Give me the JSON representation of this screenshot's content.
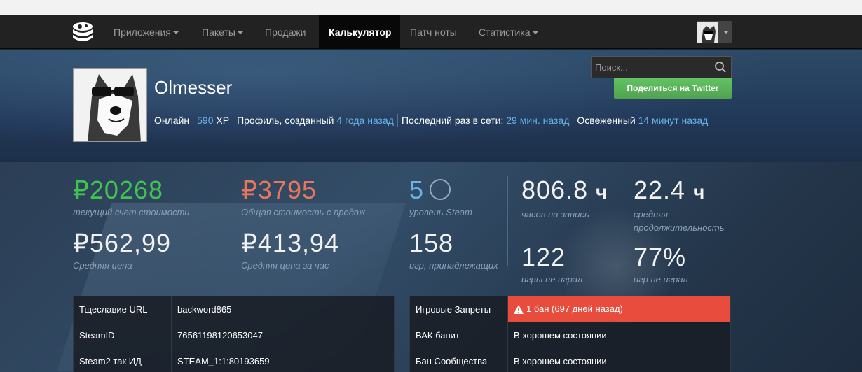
{
  "nav": {
    "items": [
      {
        "label": "Приложения",
        "dropdown": true
      },
      {
        "label": "Пакеты",
        "dropdown": true
      },
      {
        "label": "Продажи",
        "dropdown": false
      },
      {
        "label": "Калькулятор",
        "dropdown": false,
        "active": true
      },
      {
        "label": "Патч ноты",
        "dropdown": false
      },
      {
        "label": "Статистика",
        "dropdown": true
      }
    ]
  },
  "search": {
    "placeholder": "Поиск..."
  },
  "share_button": "Поделиться на Twitter",
  "profile": {
    "name": "Olmesser",
    "status": "Онлайн",
    "xp_value": "590",
    "xp_unit": "XP",
    "created_label": "Профиль, созданный",
    "created_value": "4 года назад",
    "last_online_label": "Последний раз в сети:",
    "last_online_value": "29 мин. назад",
    "refreshed_label": "Освеженный",
    "refreshed_value": "14 минут назад"
  },
  "stats": {
    "account_value": {
      "value": "₽20268",
      "label": "текущий счет стоимости"
    },
    "sale_value": {
      "value": "₽3795",
      "label": "Общая стоимость с продаж"
    },
    "level": {
      "value": "5",
      "label": "уровень Steam"
    },
    "hours": {
      "value": "806.8",
      "unit": "ч",
      "label": "часов на запись"
    },
    "avg_duration": {
      "value": "22.4",
      "unit": "ч",
      "label": "средняя продолжительность"
    },
    "avg_price": {
      "value": "₽562,99",
      "label": "Средняя цена"
    },
    "avg_price_hour": {
      "value": "₽413,94",
      "label": "Средняя цена за час"
    },
    "games_owned": {
      "value": "158",
      "label": "игр, принадлежащих"
    },
    "not_played": {
      "value": "122",
      "label": "игры не играл"
    },
    "not_played_pct": {
      "value": "77%",
      "label": "игр не играл"
    }
  },
  "left_table": [
    {
      "key": "Тщеславие URL",
      "value": "backword865"
    },
    {
      "key": "SteamID",
      "value": "76561198120653047"
    },
    {
      "key": "Steam2 так ИД",
      "value": "STEAM_1:1:80193659"
    }
  ],
  "right_table": [
    {
      "key": "Игровые Запреты",
      "value": "1 бан (697 дней назад)",
      "status": "ban"
    },
    {
      "key": "ВАК банит",
      "value": "В хорошем состоянии"
    },
    {
      "key": "Бан Сообщества",
      "value": "В хорошем состоянии"
    }
  ],
  "colors": {
    "positive": "#3fc351",
    "negative": "#e8765d",
    "link": "#66b3e8",
    "ban": "#e74c3c",
    "twitter": "#5bb75b"
  }
}
